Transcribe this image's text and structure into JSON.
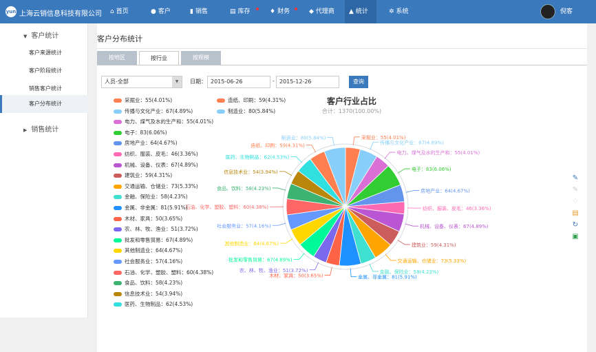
{
  "app": {
    "logo": "yun",
    "company": "上海云销信息科技有限公司",
    "user": "倪客"
  },
  "nav": [
    {
      "label": "首页",
      "icon": "home-icon",
      "glyph": "⌂",
      "dot": false
    },
    {
      "label": "客户",
      "icon": "user-icon",
      "glyph": "●",
      "dot": false
    },
    {
      "label": "销售",
      "icon": "bar-chart-icon",
      "glyph": "▮",
      "dot": false
    },
    {
      "label": "库存",
      "icon": "warehouse-icon",
      "glyph": "▤",
      "dot": true
    },
    {
      "label": "财务",
      "icon": "money-bag-icon",
      "glyph": "♦",
      "dot": true
    },
    {
      "label": "代理商",
      "icon": "users-icon",
      "glyph": "◆",
      "dot": false
    },
    {
      "label": "统计",
      "icon": "stats-icon",
      "glyph": "▲",
      "dot": false
    },
    {
      "label": "系统",
      "icon": "gear-icon",
      "glyph": "✲",
      "dot": false
    }
  ],
  "sidebar": {
    "group1": "客户统计",
    "items": [
      "客户来源统计",
      "客户阶段统计",
      "销售客户统计",
      "客户分布统计"
    ],
    "group2": "销售统计"
  },
  "page": {
    "title": "客户分布统计",
    "tabs": [
      "按地区",
      "按行业",
      "按规模"
    ]
  },
  "filter": {
    "select": "人员-全部",
    "date_label": "日期：",
    "start": "2015-06-26",
    "end": "2015-12-26",
    "dash": "-",
    "query": "查询"
  },
  "chart_data": {
    "type": "pie",
    "title": "客户行业占比",
    "subtitle": "合计：1370(100.00%)",
    "total": 1370,
    "slices": [
      {
        "name": "采掘业",
        "value": 55,
        "pct": "4.01%",
        "color": "#ff7f50"
      },
      {
        "name": "传播与文化产业",
        "value": 67,
        "pct": "4.89%",
        "color": "#87cefa"
      },
      {
        "name": "电力、煤气及水的生产和",
        "value": 55,
        "pct": "4.01%",
        "color": "#da70d6"
      },
      {
        "name": "电子",
        "value": 83,
        "pct": "6.06%",
        "color": "#32cd32"
      },
      {
        "name": "房地产业",
        "value": 64,
        "pct": "4.67%",
        "color": "#6495ed"
      },
      {
        "name": "纺织、服装、皮毛",
        "value": 46,
        "pct": "3.36%",
        "color": "#ff69b4"
      },
      {
        "name": "机械、设备、仪表",
        "value": 67,
        "pct": "4.89%",
        "color": "#ba55d3"
      },
      {
        "name": "建筑业",
        "value": 59,
        "pct": "4.31%",
        "color": "#cd5c5c"
      },
      {
        "name": "交通运输、仓储业",
        "value": 73,
        "pct": "5.33%",
        "color": "#ffa500"
      },
      {
        "name": "金融、保险业",
        "value": 58,
        "pct": "4.23%",
        "color": "#40e0d0"
      },
      {
        "name": "金属、非金属",
        "value": 81,
        "pct": "5.91%",
        "color": "#1e90ff"
      },
      {
        "name": "木材、家具",
        "value": 50,
        "pct": "3.65%",
        "color": "#ff6347"
      },
      {
        "name": "农、林、牧、渔业",
        "value": 51,
        "pct": "3.72%",
        "color": "#7b68ee"
      },
      {
        "name": "批发和零售贸易",
        "value": 67,
        "pct": "4.89%",
        "color": "#00fa9a"
      },
      {
        "name": "其他制造业",
        "value": 64,
        "pct": "4.67%",
        "color": "#ffd700"
      },
      {
        "name": "社会服务业",
        "value": 57,
        "pct": "4.16%",
        "color": "#6699ff"
      },
      {
        "name": "石油、化学、塑胶、塑料",
        "value": 60,
        "pct": "4.38%",
        "color": "#ff6666"
      },
      {
        "name": "食品、饮料",
        "value": 58,
        "pct": "4.23%",
        "color": "#3cb371"
      },
      {
        "name": "信息技术业",
        "value": 54,
        "pct": "3.94%",
        "color": "#b8860b"
      },
      {
        "name": "医药、生物制品",
        "value": 62,
        "pct": "4.53%",
        "color": "#30e0e0"
      },
      {
        "name": "造纸、印刷",
        "value": 59,
        "pct": "4.31%",
        "color": "#ff7f50"
      },
      {
        "name": "制造业",
        "value": 80,
        "pct": "5.84%",
        "color": "#87cefa"
      }
    ]
  },
  "toolbox": [
    {
      "name": "mark-icon",
      "glyph": "✎",
      "color": "#3b79bd"
    },
    {
      "name": "mark-undo-icon",
      "glyph": "✎",
      "color": "#ccc"
    },
    {
      "name": "mark-clear-icon",
      "glyph": "♢",
      "color": "#ccc"
    },
    {
      "name": "data-view-icon",
      "glyph": "▤",
      "color": "#e0a030"
    },
    {
      "name": "restore-icon",
      "glyph": "↻",
      "color": "#3b79bd"
    },
    {
      "name": "save-image-icon",
      "glyph": "▣",
      "color": "#32a050"
    }
  ]
}
